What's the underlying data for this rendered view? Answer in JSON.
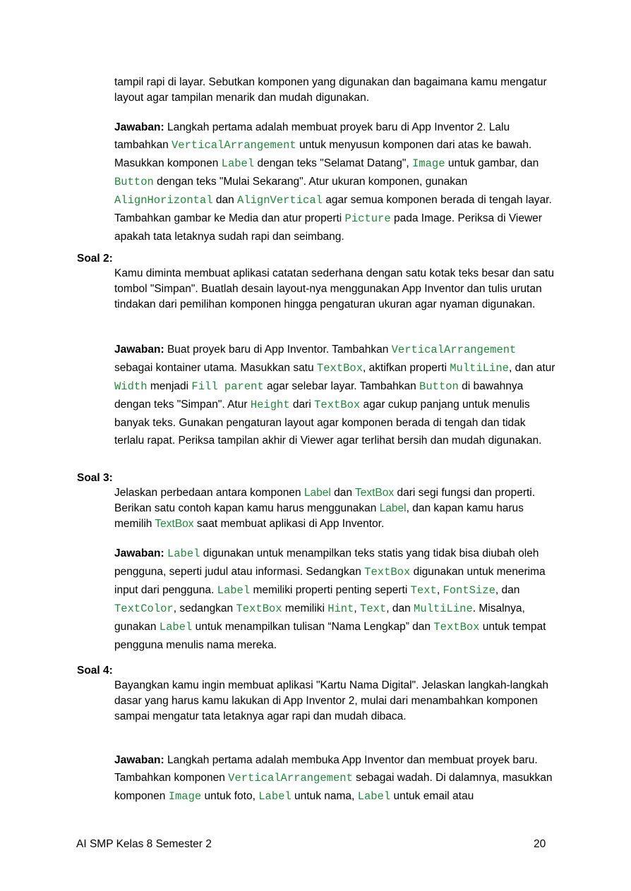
{
  "intro": {
    "q_tail": [
      "tampil rapi di layar. Sebutkan komponen yang digunakan dan bagaimana kamu mengatur layout agar tampilan menarik dan mudah digunakan."
    ],
    "answer_label": "Jawaban:",
    "answer_parts": [
      " Langkah pertama adalah membuat proyek baru di App Inventor 2. Lalu tambahkan ",
      "VerticalArrangement",
      " untuk menyusun komponen dari atas ke bawah. Masukkan komponen ",
      "Label",
      " dengan teks \"Selamat Datang\", ",
      "Image",
      " untuk gambar, dan ",
      "Button",
      " dengan teks \"Mulai Sekarang\". Atur ukuran komponen, gunakan ",
      "AlignHorizontal",
      " dan ",
      "AlignVertical",
      " agar semua komponen berada di tengah layar. Tambahkan gambar ke Media dan atur properti ",
      "Picture",
      " pada Image. Periksa di Viewer apakah tata letaknya sudah rapi dan seimbang."
    ]
  },
  "soal2": {
    "label": "Soal 2:",
    "question": "Kamu diminta membuat aplikasi catatan sederhana dengan satu kotak teks besar dan satu tombol \"Simpan\". Buatlah desain layout-nya menggunakan App Inventor dan tulis urutan tindakan dari pemilihan komponen hingga pengaturan ukuran agar nyaman digunakan.",
    "answer_label": "Jawaban:",
    "answer_parts": [
      "  Buat proyek baru di App Inventor. Tambahkan ",
      "VerticalArrangement",
      " sebagai kontainer utama. Masukkan satu ",
      "TextBox",
      ", aktifkan properti ",
      "MultiLine",
      ", dan atur ",
      "Width",
      " menjadi ",
      "Fill parent",
      " agar selebar layar. Tambahkan ",
      "Button",
      " di bawahnya dengan teks \"Simpan\". Atur ",
      "Height",
      " dari ",
      "TextBox",
      " agar cukup panjang untuk menulis banyak teks. Gunakan pengaturan layout agar komponen berada di tengah dan tidak terlalu rapat. Periksa tampilan akhir di Viewer agar terlihat bersih dan mudah digunakan."
    ]
  },
  "soal3": {
    "label": "Soal 3:",
    "question_parts": [
      "Jelaskan perbedaan antara komponen ",
      "Label",
      " dan ",
      "TextBox",
      " dari segi fungsi dan properti. Berikan satu contoh kapan kamu harus menggunakan ",
      "Label",
      ", dan kapan kamu harus memilih ",
      "TextBox",
      " saat membuat aplikasi di App Inventor."
    ],
    "answer_label": "Jawaban:",
    "answer_parts": [
      " ",
      "Label",
      " digunakan untuk menampilkan teks statis yang tidak bisa diubah oleh pengguna, seperti judul atau informasi. Sedangkan ",
      "TextBox",
      " digunakan untuk menerima input dari pengguna. ",
      "Label",
      " memiliki properti penting seperti ",
      "Text",
      ", ",
      "FontSize",
      ", dan ",
      "TextColor",
      ", sedangkan ",
      "TextBox",
      " memiliki ",
      "Hint",
      ", ",
      "Text",
      ", dan ",
      "MultiLine",
      ". Misalnya, gunakan ",
      "Label",
      " untuk menampilkan tulisan “Nama Lengkap” dan ",
      "TextBox",
      " untuk tempat pengguna menulis nama mereka."
    ]
  },
  "soal4": {
    "label": "Soal 4:",
    "question": "Bayangkan kamu ingin membuat aplikasi \"Kartu Nama Digital\". Jelaskan langkah-langkah dasar yang harus kamu lakukan di App Inventor 2, mulai dari menambahkan komponen sampai mengatur tata letaknya agar rapi dan mudah dibaca.",
    "answer_label": "Jawaban:",
    "answer_parts": [
      "  Langkah pertama adalah membuka App Inventor dan membuat proyek baru. Tambahkan komponen ",
      "VerticalArrangement",
      " sebagai wadah. Di dalamnya, masukkan komponen ",
      "Image",
      " untuk foto, ",
      "Label",
      " untuk nama, ",
      "Label",
      " untuk email atau"
    ]
  },
  "footer": {
    "left": "AI SMP Kelas 8 Semester 2",
    "page_number": "20"
  },
  "colors": {
    "code": "#1e8a3a",
    "text": "#000000"
  }
}
